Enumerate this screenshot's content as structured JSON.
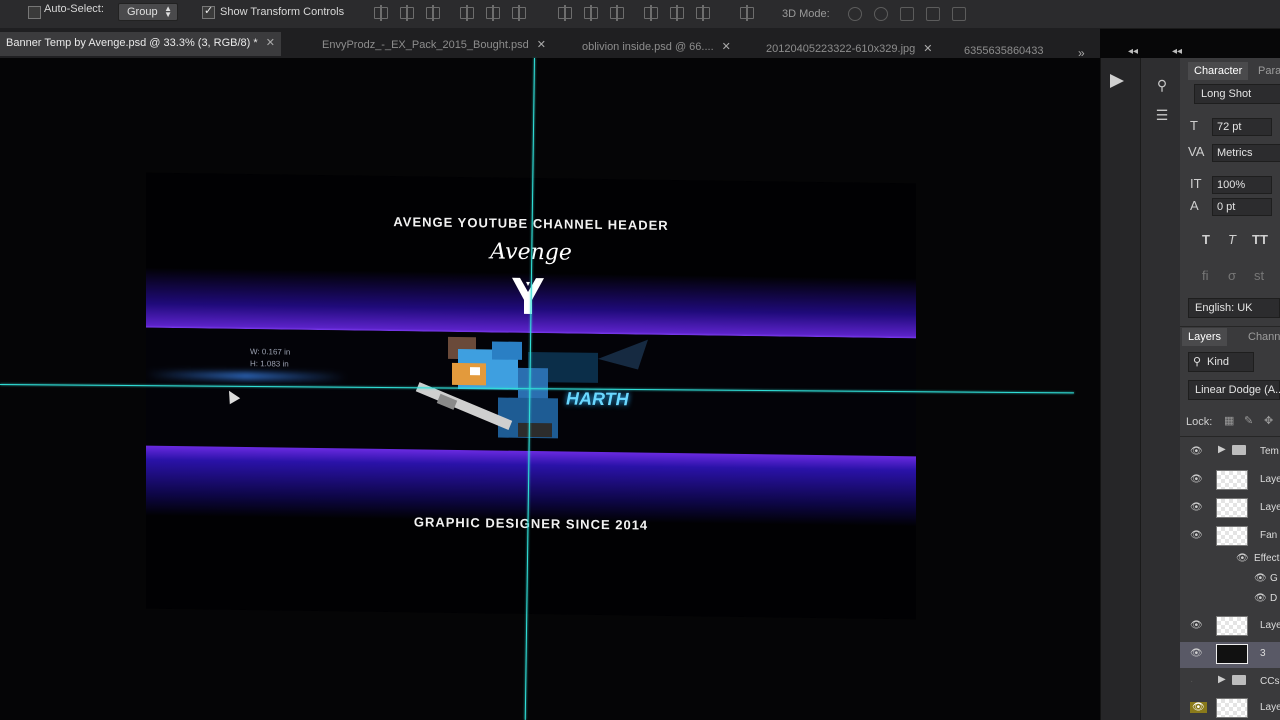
{
  "options_bar": {
    "auto_select_label": "Auto-Select:",
    "auto_select_checked": false,
    "group_value": "Group",
    "show_transform_label": "Show Transform Controls",
    "show_transform_checked": true,
    "mode_3d_label": "3D Mode:"
  },
  "tabs": [
    {
      "label": "Banner Temp by Avenge.psd @ 33.3% (3, RGB/8) *",
      "active": true
    },
    {
      "label": "EnvyProdz_-_EX_Pack_2015_Bought.psd",
      "active": false
    },
    {
      "label": "oblivion inside.psd @ 66....",
      "active": false
    },
    {
      "label": "20120405223322-610x329.jpg",
      "active": false
    },
    {
      "label": "6355635860433",
      "active": false
    }
  ],
  "tabs_more": "»",
  "banner": {
    "header_text": "AVENGE YOUTUBE CHANNEL HEADER",
    "logo_text": "Avenge",
    "measure_line1": "W: 0.167 in",
    "measure_line2": "H: 1.083 in",
    "art_text": "HARTH",
    "footer_text": "GRAPHIC DESIGNER SINCE 2014"
  },
  "character_panel": {
    "tab_character": "Character",
    "tab_paragraph": "Para",
    "font_family": "Long Shot",
    "font_size": "72 pt",
    "kerning": "Metrics",
    "vertical_scale": "100%",
    "baseline_shift": "0 pt",
    "style_buttons": [
      "T",
      "T",
      "TT"
    ],
    "ligature_icons": [
      "fi",
      "σ",
      "st"
    ],
    "language": "English: UK"
  },
  "layers_panel": {
    "tab_layers": "Layers",
    "tab_channels": "Channels",
    "filter_kind": "Kind",
    "blend_mode": "Linear Dodge (A...",
    "lock_label": "Lock:",
    "layers": [
      {
        "name": "Tem",
        "type": "group",
        "visible": true
      },
      {
        "name": "Laye",
        "type": "layer",
        "visible": true
      },
      {
        "name": "Laye",
        "type": "layer",
        "visible": true
      },
      {
        "name": "Fan",
        "type": "layer",
        "visible": true
      },
      {
        "name": "Effect",
        "type": "effects",
        "visible": true
      },
      {
        "name": "G",
        "type": "effect",
        "visible": true
      },
      {
        "name": "D",
        "type": "effect",
        "visible": true
      },
      {
        "name": "Laye",
        "type": "layer",
        "visible": true
      },
      {
        "name": "3",
        "type": "layer",
        "visible": true,
        "selected": true
      },
      {
        "name": "CCs",
        "type": "group",
        "visible": false
      },
      {
        "name": "Laye",
        "type": "layer",
        "visible": true
      }
    ]
  },
  "colors": {
    "guide": "#31e0d8",
    "banner_purple": "#5b22c8",
    "panel_bg": "#3a3a3c"
  }
}
